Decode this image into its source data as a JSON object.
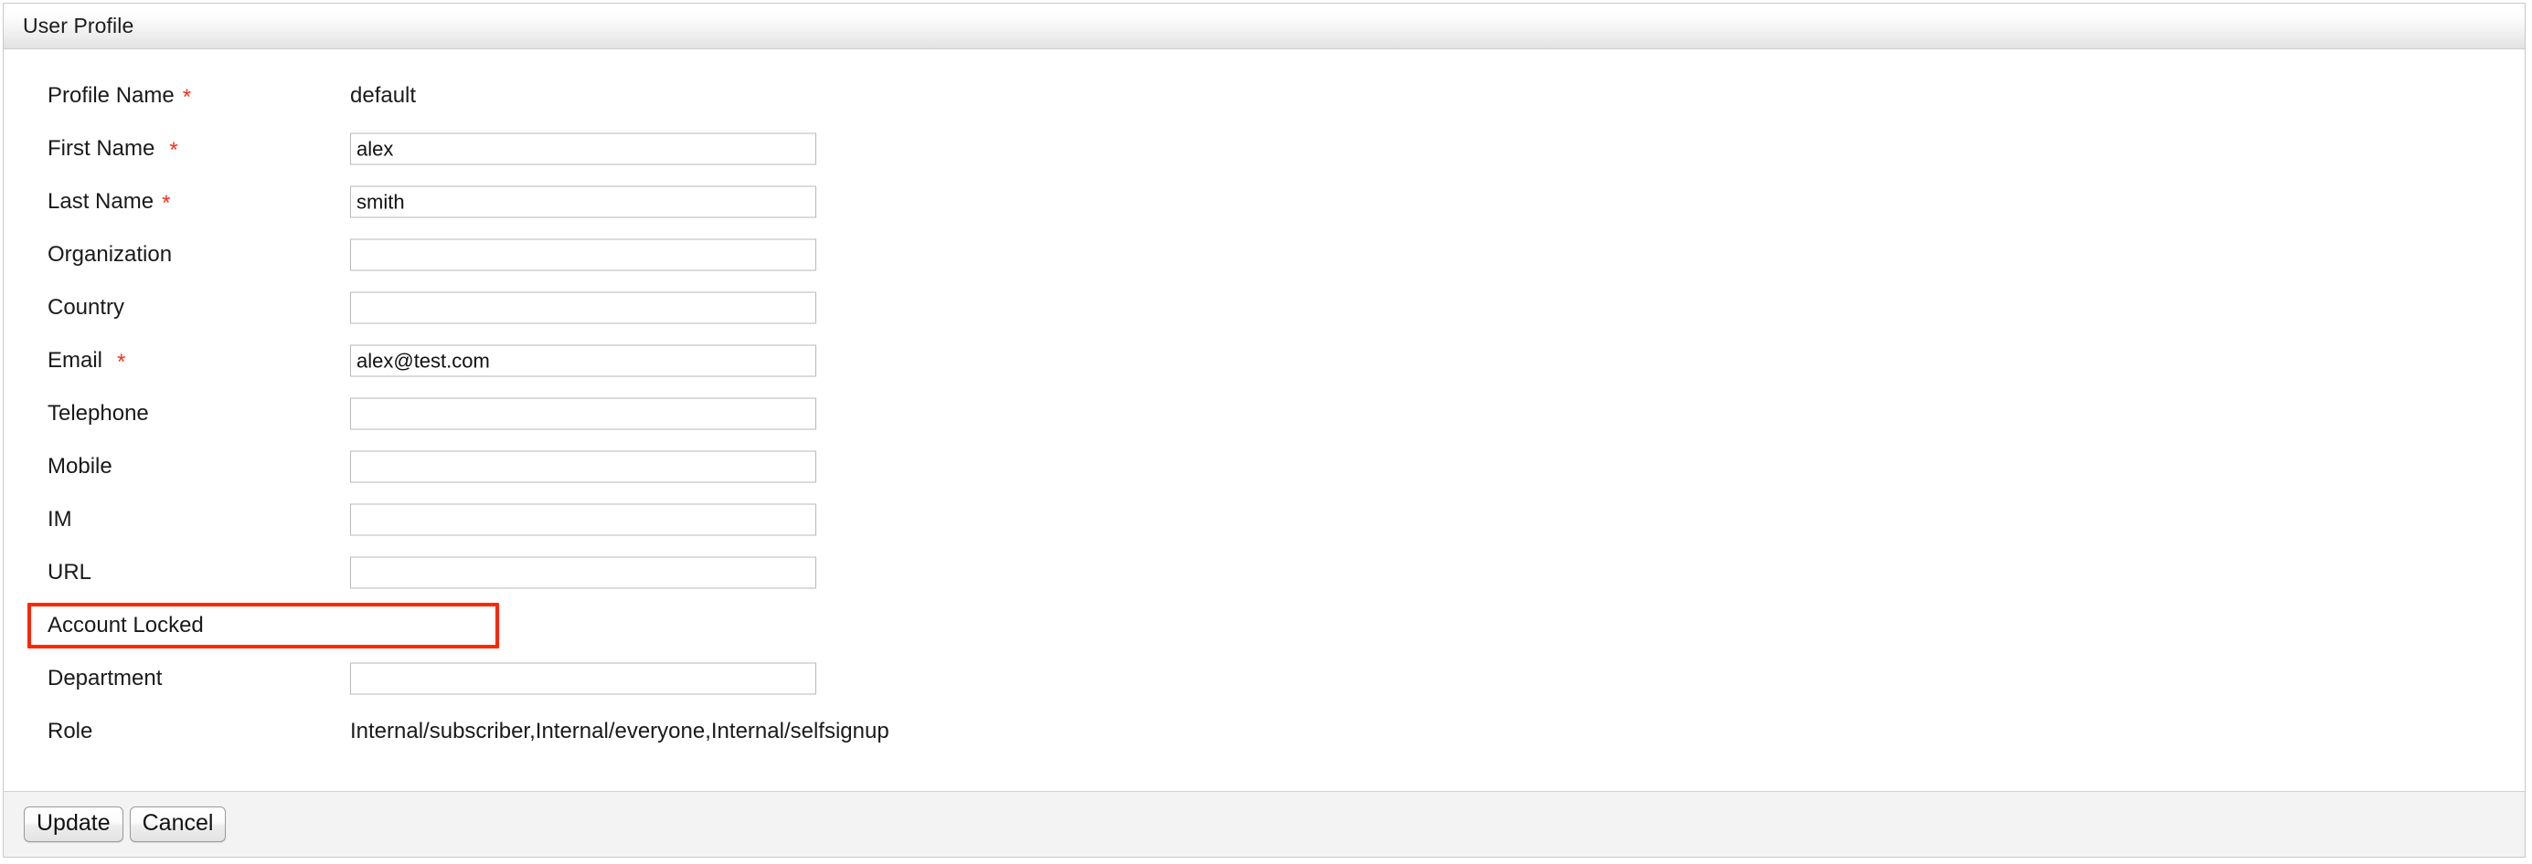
{
  "panel": {
    "title": "User Profile"
  },
  "form": {
    "rows": [
      {
        "label": "Profile Name",
        "required": true,
        "type": "static",
        "value": "default"
      },
      {
        "label": "First Name",
        "required": true,
        "type": "input",
        "value": "alex",
        "placeholder": ""
      },
      {
        "label": "Last Name",
        "required": true,
        "type": "input",
        "value": "smith",
        "placeholder": ""
      },
      {
        "label": "Organization",
        "required": false,
        "type": "input",
        "value": "",
        "placeholder": ""
      },
      {
        "label": "Country",
        "required": false,
        "type": "input",
        "value": "",
        "placeholder": ""
      },
      {
        "label": "Email",
        "required": true,
        "type": "input",
        "value": "alex@test.com",
        "placeholder": ""
      },
      {
        "label": "Telephone",
        "required": false,
        "type": "input",
        "value": "",
        "placeholder": ""
      },
      {
        "label": "Mobile",
        "required": false,
        "type": "input",
        "value": "",
        "placeholder": ""
      },
      {
        "label": "IM",
        "required": false,
        "type": "input",
        "value": "",
        "placeholder": ""
      },
      {
        "label": "URL",
        "required": false,
        "type": "input",
        "value": "",
        "placeholder": ""
      },
      {
        "label": "Account Locked",
        "required": false,
        "type": "checkbox",
        "checked": true,
        "highlighted": true
      },
      {
        "label": "Department",
        "required": false,
        "type": "input",
        "value": "",
        "placeholder": ""
      },
      {
        "label": "Role",
        "required": false,
        "type": "static",
        "value": "Internal/subscriber,Internal/everyone,Internal/selfsignup"
      }
    ],
    "required_marker": "*"
  },
  "footer": {
    "update_label": "Update",
    "cancel_label": "Cancel"
  },
  "colors": {
    "required_asterisk": "#ff2d16",
    "highlight_border": "#ff2600",
    "checkbox_fill": "#3b7ee8",
    "header_border": "#cfcfcf",
    "input_border": "#b9b9b9",
    "footer_background": "#f3f3f3"
  }
}
